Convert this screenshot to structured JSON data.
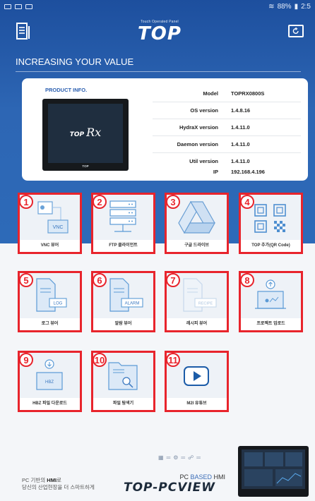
{
  "status": {
    "time": "2:5",
    "battery": "88%"
  },
  "header": {
    "logo_subtitle": "Touch Operated Panel",
    "logo": "TOP"
  },
  "tagline": "INCREASING YOUR VALUE",
  "product": {
    "label": "PRODUCT INFO.",
    "device_prefix": "TOP",
    "device_brand": "Rx",
    "device_footer": "TOP",
    "rows": [
      {
        "key": "Model",
        "value": "TOPRX0800S"
      },
      {
        "key": "OS version",
        "value": "1.4.8.16"
      },
      {
        "key": "HydraX version",
        "value": "1.4.11.0"
      },
      {
        "key": "Daemon version",
        "value": "1.4.11.0"
      },
      {
        "key": "Util version",
        "value": "1.4.11.0"
      },
      {
        "key": "IP",
        "value": "192.168.4.196"
      }
    ]
  },
  "tiles": [
    {
      "num": "1",
      "label": "VNC 뷰어",
      "icon": "vnc-icon",
      "art_text": "VNC"
    },
    {
      "num": "2",
      "label": "FTP 클라이언트",
      "icon": "server-icon",
      "art_text": ""
    },
    {
      "num": "3",
      "label": "구글 드라이브",
      "icon": "google-drive-icon",
      "art_text": ""
    },
    {
      "num": "4",
      "label": "TOP 추가(QR Code)",
      "icon": "qr-code-icon",
      "art_text": ""
    },
    {
      "num": "5",
      "label": "로그 뷰어",
      "icon": "log-document-icon",
      "art_text": "LOG"
    },
    {
      "num": "6",
      "label": "알람 뷰어",
      "icon": "alarm-document-icon",
      "art_text": "ALARM"
    },
    {
      "num": "7",
      "label": "레시피 뷰어",
      "icon": "recipe-document-icon",
      "art_text": "RECIPE"
    },
    {
      "num": "8",
      "label": "프로젝트 업로드",
      "icon": "project-upload-icon",
      "art_text": ""
    },
    {
      "num": "9",
      "label": "HBZ 파일 다운로드",
      "icon": "hbz-download-icon",
      "art_text": "HBZ"
    },
    {
      "num": "10",
      "label": "파일 탐색기",
      "icon": "file-explorer-icon",
      "art_text": ""
    },
    {
      "num": "11",
      "label": "M2I 유튜브",
      "icon": "youtube-play-icon",
      "art_text": ""
    }
  ],
  "footer": {
    "line1_prefix": "PC 기반의 ",
    "line1_bold": "HMI",
    "line1_suffix": "로",
    "line2": "당신의 산업현장을 더 스마트하게",
    "small_prefix": "PC ",
    "small_highlight": "BASED",
    "small_suffix": " HMI",
    "brand": "TOP-PCVIEW"
  }
}
